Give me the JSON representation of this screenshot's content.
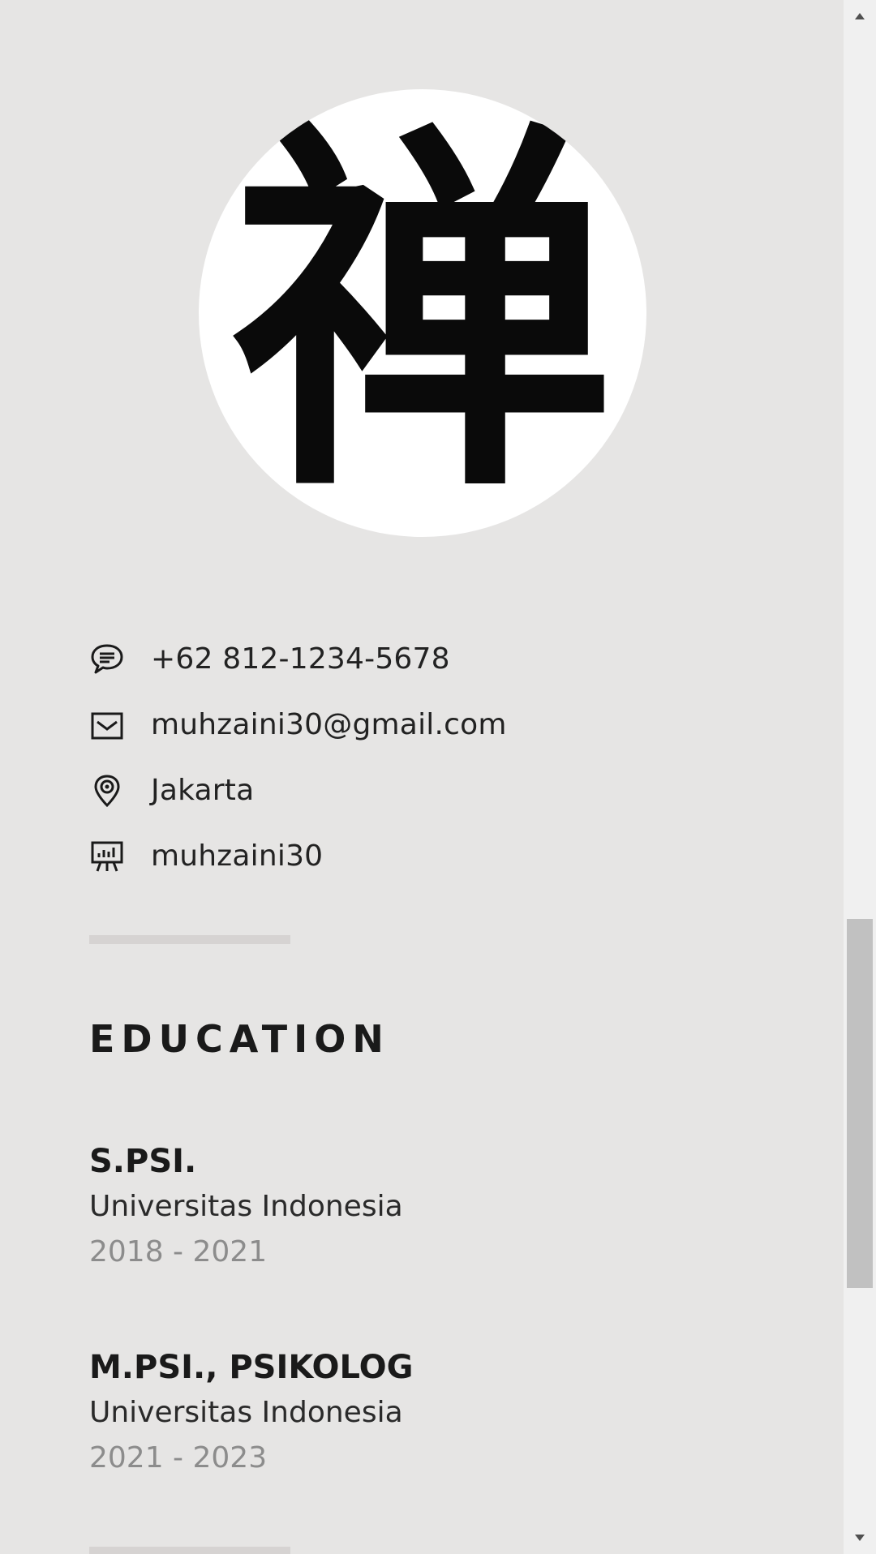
{
  "avatar": {
    "glyph": "禅"
  },
  "contacts": [
    {
      "icon": "chat-bubble-icon",
      "text": "+62 812-1234-5678"
    },
    {
      "icon": "mail-icon",
      "text": "muhzaini30@gmail.com"
    },
    {
      "icon": "location-pin-icon",
      "text": "Jakarta"
    },
    {
      "icon": "presentation-board-icon",
      "text": "muhzaini30"
    }
  ],
  "education": {
    "title": "EDUCATION",
    "items": [
      {
        "degree": "S.PSI.",
        "school": "Universitas Indonesia",
        "years": "2018 - 2021"
      },
      {
        "degree": "M.PSI., PSIKOLOG",
        "school": "Universitas Indonesia",
        "years": "2021 - 2023"
      }
    ]
  },
  "scrollbar": {
    "position_fraction": 0.59
  }
}
